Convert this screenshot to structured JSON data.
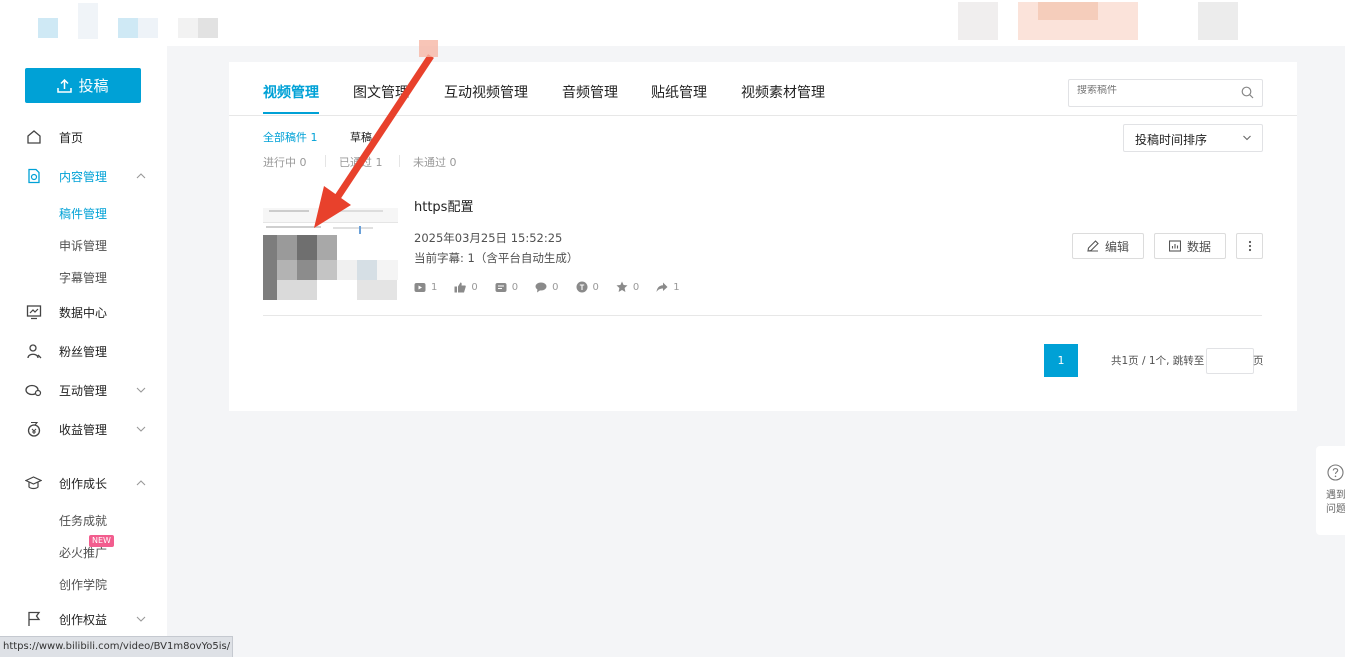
{
  "sidebar": {
    "upload_label": "投稿",
    "items": [
      {
        "label": "首页",
        "icon": "home-icon"
      },
      {
        "label": "内容管理",
        "icon": "content-icon"
      },
      {
        "label": "数据中心",
        "icon": "data-center-icon"
      },
      {
        "label": "粉丝管理",
        "icon": "fans-icon"
      },
      {
        "label": "互动管理",
        "icon": "interaction-icon"
      },
      {
        "label": "收益管理",
        "icon": "income-icon"
      },
      {
        "label": "创作成长",
        "icon": "growth-icon"
      },
      {
        "label": "创作权益",
        "icon": "rights-icon"
      }
    ],
    "content_sub": [
      "稿件管理",
      "申诉管理",
      "字幕管理"
    ],
    "growth_sub": [
      "任务成就",
      "必火推广",
      "创作学院"
    ],
    "new_badge": "NEW"
  },
  "tabs": [
    "视频管理",
    "图文管理",
    "互动视频管理",
    "音频管理",
    "贴纸管理",
    "视频素材管理"
  ],
  "search": {
    "placeholder": "搜索稿件"
  },
  "filters": {
    "all": "全部稿件 1",
    "draft": "草稿"
  },
  "status_filters": [
    "进行中 0",
    "已通过 1",
    "未通过 0"
  ],
  "sort": {
    "label": "投稿时间排序"
  },
  "video": {
    "title": "https配置",
    "date": "2025年03月25日 15:52:25",
    "subtitle_info": "当前字幕: 1（含平台自动生成）",
    "stats": [
      {
        "icon": "play-icon",
        "value": "1"
      },
      {
        "icon": "like-icon",
        "value": "0"
      },
      {
        "icon": "danmaku-icon",
        "value": "0"
      },
      {
        "icon": "comment-icon",
        "value": "0"
      },
      {
        "icon": "coin-icon",
        "value": "0"
      },
      {
        "icon": "favorite-icon",
        "value": "0"
      },
      {
        "icon": "share-icon",
        "value": "1"
      }
    ],
    "edit_label": "编辑",
    "data_label": "数据"
  },
  "pagination": {
    "current": "1",
    "info": "共1页 / 1个, 跳转至",
    "unit": "页"
  },
  "help": {
    "line1": "遇到",
    "line2": "问题"
  },
  "status_url": "https://www.bilibili.com/video/BV1m8ovYo5is/",
  "colors": {
    "accent": "#00a1d6",
    "arrow": "#e8412c",
    "badge": "#f25d8e"
  }
}
